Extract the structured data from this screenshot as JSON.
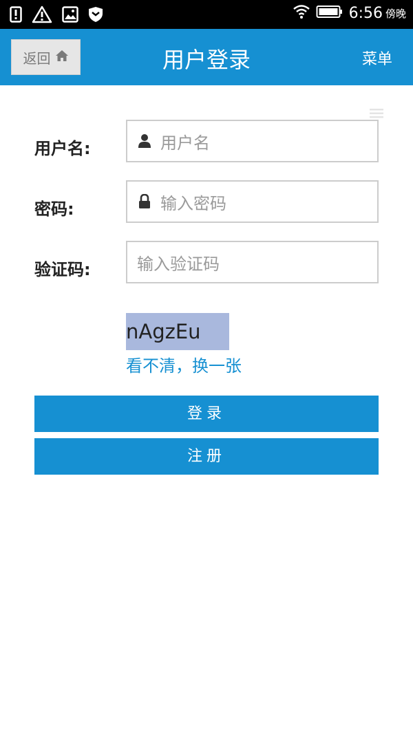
{
  "status_bar": {
    "time": "6:56",
    "period": "傍晚"
  },
  "header": {
    "back_label": "返回",
    "title": "用户登录",
    "menu_label": "菜单"
  },
  "form": {
    "username": {
      "label": "用户名:",
      "placeholder": "用户名"
    },
    "password": {
      "label": "密码:",
      "placeholder": "输入密码"
    },
    "captcha": {
      "label": "验证码:",
      "placeholder": "输入验证码",
      "code": "nAgzEu",
      "refresh_text": "看不清，换一张"
    }
  },
  "buttons": {
    "login": "登录",
    "register": "注册"
  },
  "colors": {
    "primary": "#1690d2",
    "captcha_bg": "#a9b8dd",
    "back_button_bg": "#e6e6e6"
  },
  "icons": {
    "status_left": [
      "alert-icon",
      "warning-icon",
      "image-icon",
      "shield-icon"
    ],
    "status_right": [
      "wifi-icon",
      "battery-icon"
    ],
    "back": "home-icon",
    "username": "user-icon",
    "password": "lock-icon",
    "panel": "hamburger-icon"
  }
}
